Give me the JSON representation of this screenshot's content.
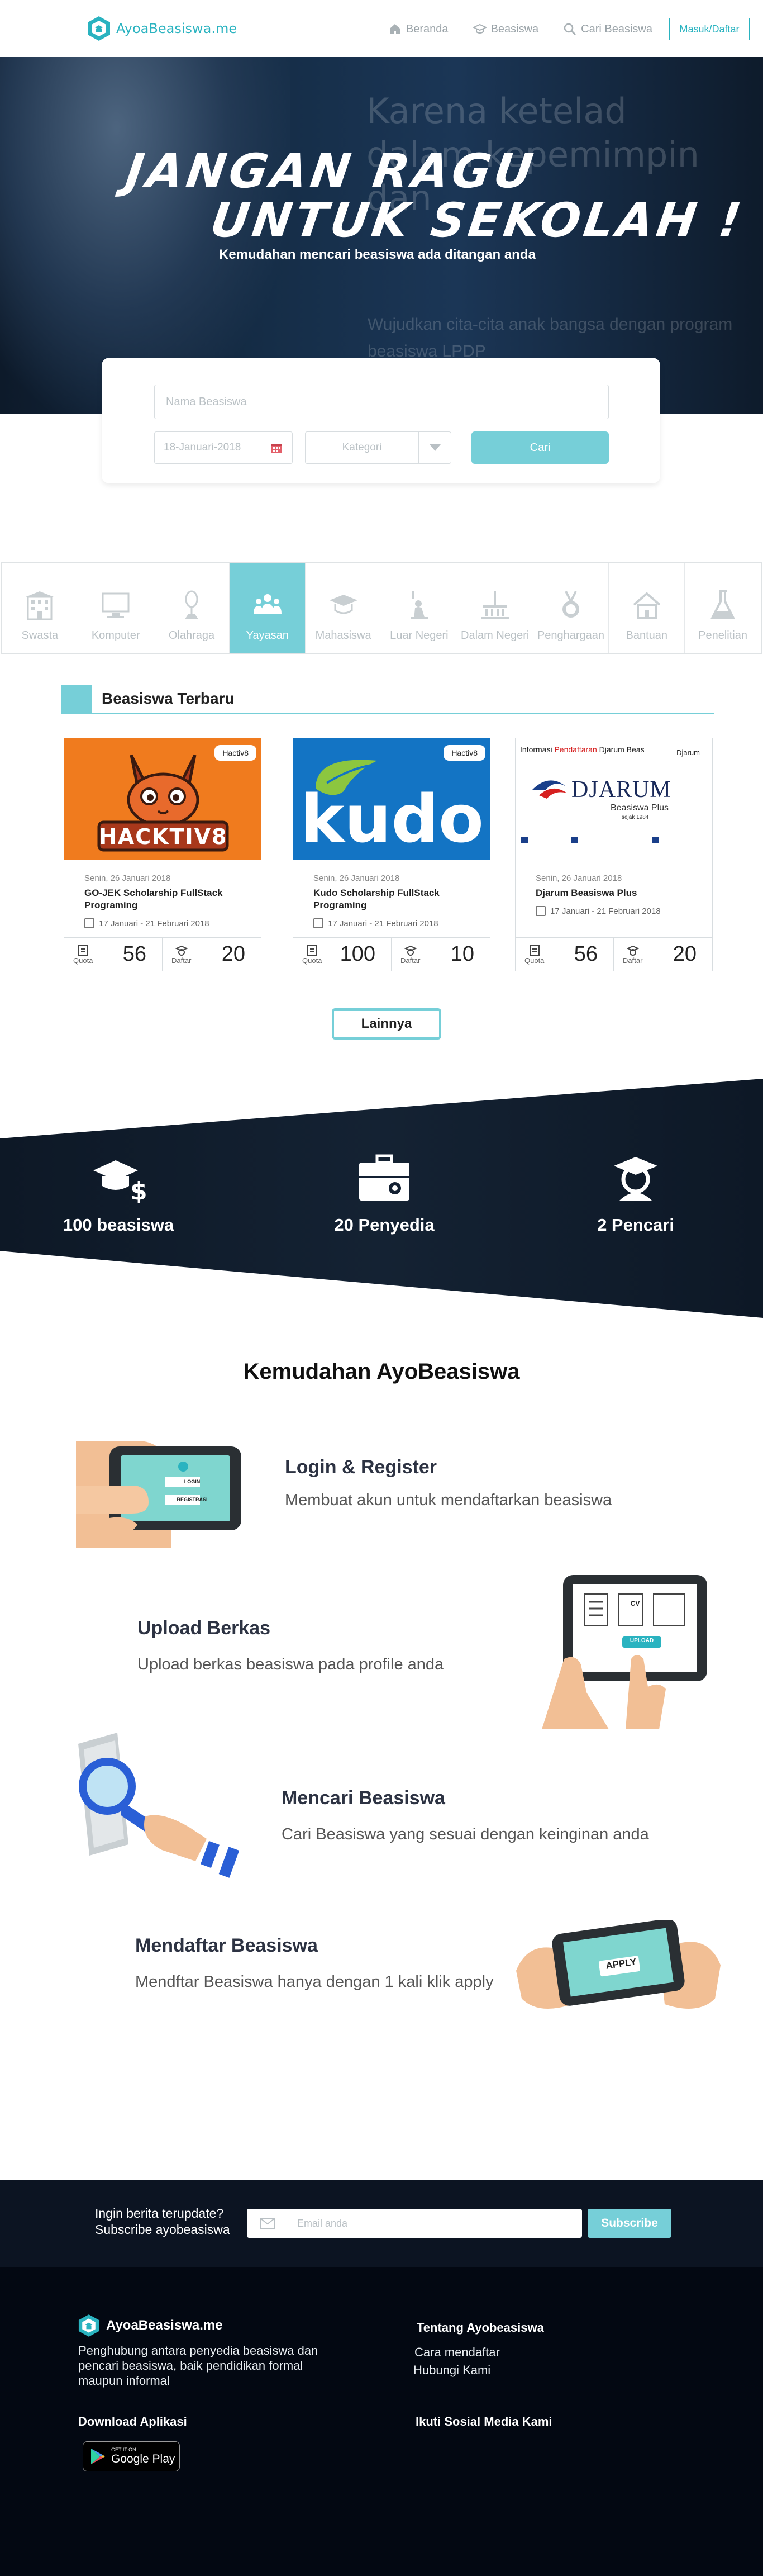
{
  "nav": {
    "brand": "AyoaBeasiswa.me",
    "links": [
      {
        "label": "Beranda",
        "icon": "home-icon"
      },
      {
        "label": "Beasiswa",
        "icon": "graduation-cap-icon"
      },
      {
        "label": "Cari Beasiswa",
        "icon": "search-icon"
      }
    ],
    "login": "Masuk/Daftar"
  },
  "hero": {
    "line1": "JANGAN RAGU",
    "line2": "UNTUK SEKOLAH !",
    "subtitle": "Kemudahan mencari beasiswa ada ditangan anda",
    "bg_line1": "Karena ketelad",
    "bg_line2": "dalam kepemimpin",
    "bg_line3": "dan",
    "bg_line4": "Wujudkan cita-cita anak bangsa dengan program",
    "bg_line5": "beasiswa LPDP"
  },
  "search": {
    "name_placeholder": "Nama Beasiswa",
    "date_value": "18-Januari-2018",
    "category_placeholder": "Kategori",
    "button": "Cari"
  },
  "categories": [
    {
      "label": "Swasta",
      "icon": "building-icon",
      "active": false
    },
    {
      "label": "Komputer",
      "icon": "monitor-icon",
      "active": false
    },
    {
      "label": "Olahraga",
      "icon": "trophy-icon",
      "active": false
    },
    {
      "label": "Yayasan",
      "icon": "people-icon",
      "active": true
    },
    {
      "label": "Mahasiswa",
      "icon": "graduate-icon",
      "active": false
    },
    {
      "label": "Luar Negeri",
      "icon": "liberty-icon",
      "active": false
    },
    {
      "label": "Dalam Negeri",
      "icon": "monument-icon",
      "active": false
    },
    {
      "label": "Penghargaan",
      "icon": "medal-icon",
      "active": false
    },
    {
      "label": "Bantuan",
      "icon": "house-icon",
      "active": false
    },
    {
      "label": "Penelitian",
      "icon": "flask-icon",
      "active": false
    }
  ],
  "latest": {
    "title": "Beasiswa Terbaru",
    "cards": [
      {
        "tag": "Hactiv8",
        "logo_text": "HACKTIV8",
        "date": "Senin, 26 Januari 2018",
        "title": "GO-JEK Scholarship FullStack Programing",
        "range": "17 Januari - 21 Februari 2018",
        "quota_label": "Quota",
        "quota": "56",
        "daftar_label": "Daftar",
        "daftar": "20"
      },
      {
        "tag": "Hactiv8",
        "logo_text": "kudo",
        "date": "Senin, 26 Januari 2018",
        "title": "Kudo Scholarship FullStack Programing",
        "range": "17 Januari - 21 Februari 2018",
        "quota_label": "Quota",
        "quota": "100",
        "daftar_label": "Daftar",
        "daftar": "10"
      },
      {
        "tag": "Djarum",
        "logo_text": "DJARUM",
        "date": "Senin, 26 Januari 2018",
        "title": "Djarum Beasiswa Plus",
        "range": "17 Januari - 21 Februari 2018",
        "quota_label": "Quota",
        "quota": "56",
        "daftar_label": "Daftar",
        "daftar": "20",
        "poster_head_a": "Informasi ",
        "poster_head_b": "Pendaftaran",
        "poster_head_c": " Djarum Beas",
        "poster_sub": "Beasiswa Plus",
        "poster_since": "sejak 1984"
      }
    ],
    "more": "Lainnya"
  },
  "stats": [
    {
      "label": "100 beasiswa",
      "icon": "graduation-money-icon"
    },
    {
      "label": "20 Penyedia",
      "icon": "briefcase-icon"
    },
    {
      "label": "2 Pencari",
      "icon": "student-icon"
    }
  ],
  "features": {
    "title": "Kemudahan AyoBeasiswa",
    "steps": [
      {
        "title": "Login & Register",
        "desc": "Membuat akun untuk mendaftarkan beasiswa",
        "screen1": "LOGIN",
        "screen2": "REGISTRASI"
      },
      {
        "title": "Upload Berkas",
        "desc": "Upload berkas beasiswa pada profile anda",
        "screen1": "CV",
        "screen2": "UPLOAD"
      },
      {
        "title": "Mencari Beasiswa",
        "desc": "Cari Beasiswa yang sesuai dengan keinginan anda"
      },
      {
        "title": "Mendaftar Beasiswa",
        "desc": "Mendftar Beasiswa hanya dengan 1 kali klik apply",
        "screen1": "APPLY"
      }
    ]
  },
  "subscribe": {
    "line1": "Ingin berita terupdate?",
    "line2": "Subscribe ayobeasiswa",
    "placeholder": "Email anda",
    "button": "Subscribe"
  },
  "footer": {
    "brand": "AyoaBeasiswa.me",
    "desc": "Penghubung antara penyedia beasiswa dan pencari beasiswa, baik pendidikan formal maupun informal",
    "download_title": "Download Aplikasi",
    "gplay_small": "GET IT ON",
    "gplay_big": "Google Play",
    "about_title": "Tentang Ayobeasiswa",
    "links": [
      "Cara mendaftar",
      "Hubungi Kami"
    ],
    "social_title": "Ikuti Sosial Media Kami"
  },
  "colors": {
    "accent": "#76cfd8",
    "brand": "#2ab3c0",
    "dark": "#0c1422"
  }
}
